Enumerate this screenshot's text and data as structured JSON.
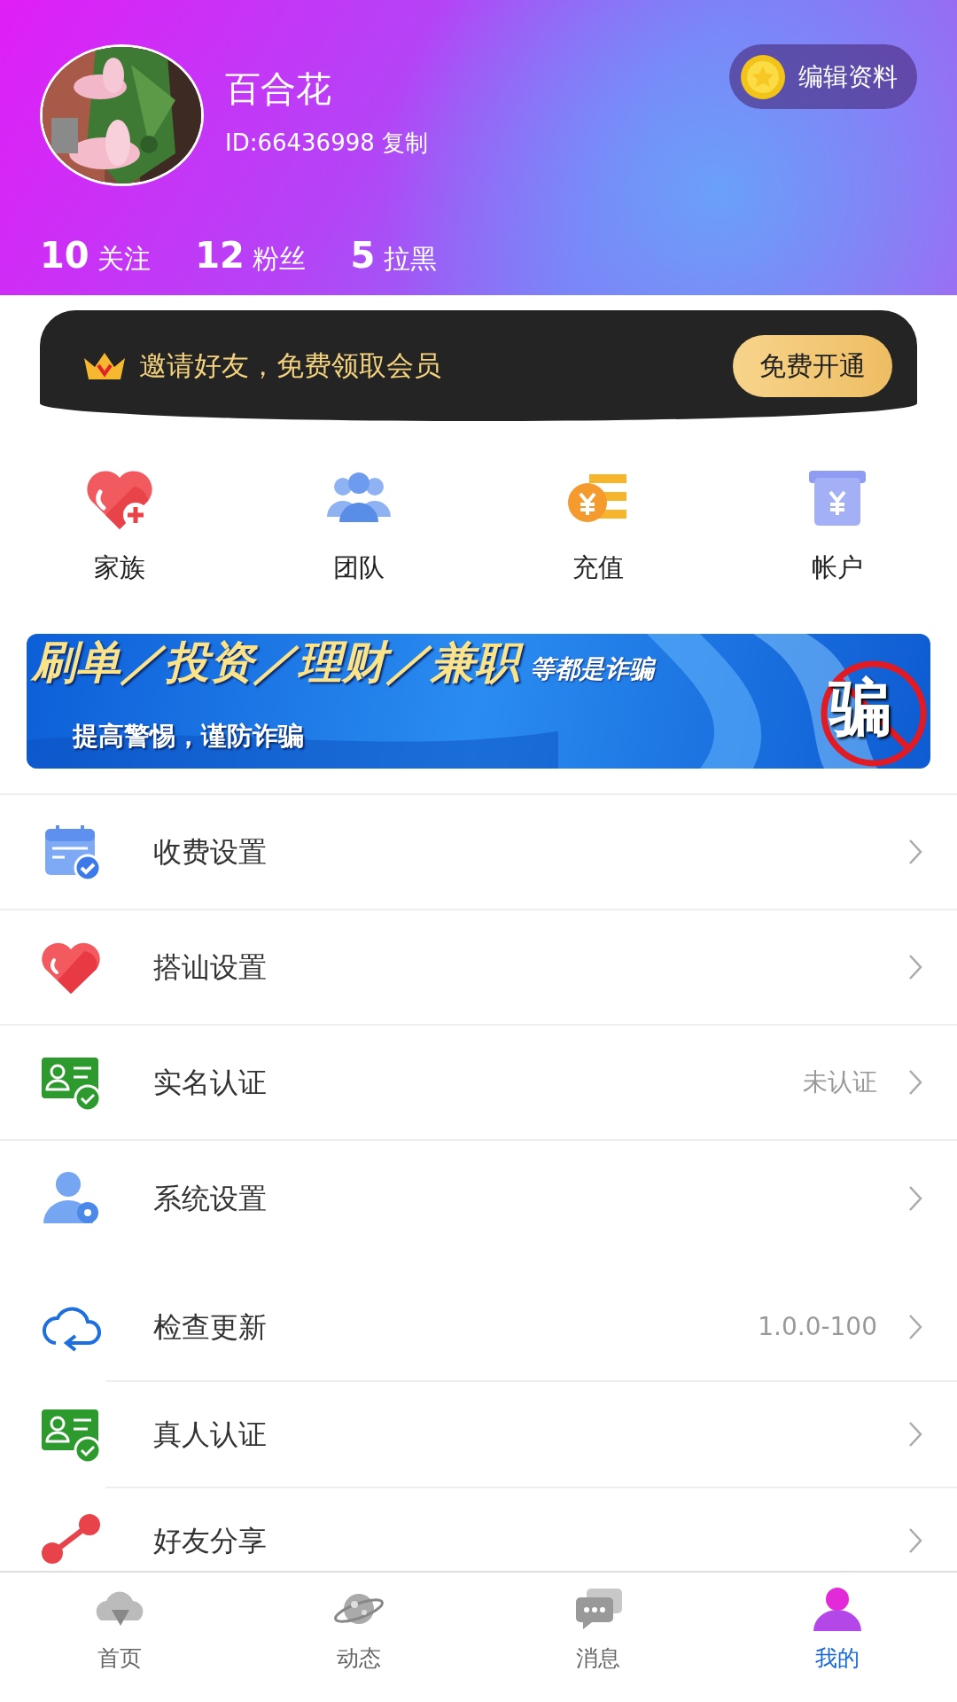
{
  "profile": {
    "name": "百合花",
    "id_text": "ID:66436998",
    "copy_link": "复制",
    "edit_button": "编辑资料"
  },
  "stats": [
    {
      "text": "**10** 关注"
    },
    {
      "text": "**12** 粉丝"
    },
    {
      "text": "**5** 拉黑"
    }
  ],
  "invite_banner": {
    "text": "邀请好友，免费领取会员",
    "button": "免费开通"
  },
  "shortcuts": [
    {
      "label": "家族",
      "kind": "family"
    },
    {
      "label": "团队",
      "kind": "team"
    },
    {
      "label": "充值",
      "kind": "recharge"
    },
    {
      "label": "帐户",
      "kind": "account"
    }
  ],
  "fraud_banner": {
    "headline": "刷单／投资／理财／兼职",
    "headline_suffix": "等都是诈骗",
    "subline": "提高警惕，谨防诈骗",
    "stamp": "骗"
  },
  "menu_groups": [
    [
      {
        "label": "收费设置",
        "kind": "calendar"
      },
      {
        "label": "搭讪设置",
        "kind": "heart"
      },
      {
        "label": "实名认证",
        "kind": "idcard",
        "value": "未认证"
      },
      {
        "label": "系统设置",
        "kind": "usergear"
      }
    ],
    [
      {
        "label": "检查更新",
        "kind": "cloud",
        "value": "1.0.0-100"
      },
      {
        "label": "真人认证",
        "kind": "idcard"
      },
      {
        "label": "好友分享",
        "kind": "share"
      }
    ]
  ],
  "bottom_nav": [
    {
      "label": "首页",
      "kind": "home",
      "selected": false
    },
    {
      "label": "动态",
      "kind": "planet",
      "selected": false
    },
    {
      "label": "消息",
      "kind": "chat",
      "selected": false
    },
    {
      "label": "我的",
      "kind": "me",
      "selected": true
    }
  ]
}
